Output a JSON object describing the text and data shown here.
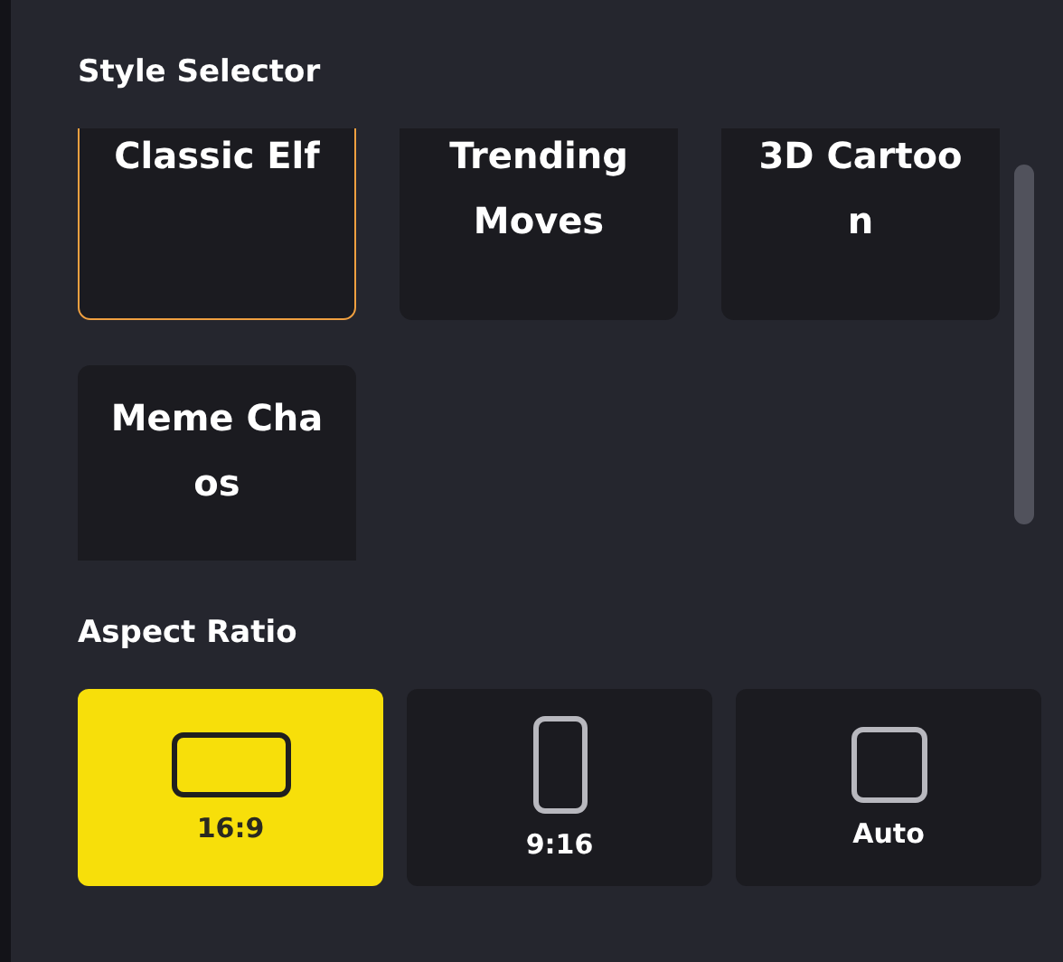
{
  "style_selector": {
    "title": "Style Selector",
    "styles": [
      {
        "label": "Classic Elf",
        "selected": true
      },
      {
        "label": "Trending Moves",
        "selected": false
      },
      {
        "label": "3D Cartoon",
        "selected": false
      },
      {
        "label": "Meme Chaos",
        "selected": false
      }
    ]
  },
  "aspect_ratio": {
    "title": "Aspect Ratio",
    "options": [
      {
        "label": "16:9",
        "kind": "landscape",
        "selected": true
      },
      {
        "label": "9:16",
        "kind": "portrait",
        "selected": false
      },
      {
        "label": "Auto",
        "kind": "square",
        "selected": false
      }
    ]
  }
}
